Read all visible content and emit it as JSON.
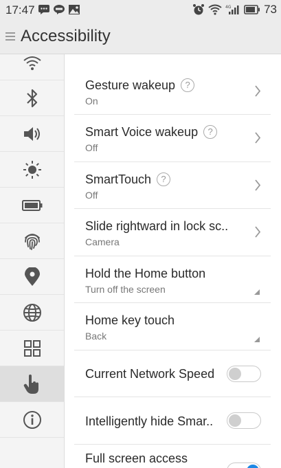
{
  "status_bar": {
    "time": "17:47",
    "battery": "73",
    "left_icons": [
      "message-icon",
      "line-icon",
      "image-icon"
    ],
    "right_icons": [
      "alarm-icon",
      "wifi-icon",
      "signal-4g-icon",
      "battery-icon"
    ]
  },
  "header": {
    "title": "Accessibility"
  },
  "sidebar": {
    "items": [
      {
        "icon": "wifi-icon"
      },
      {
        "icon": "bluetooth-icon"
      },
      {
        "icon": "sound-icon"
      },
      {
        "icon": "brightness-icon"
      },
      {
        "icon": "battery-icon"
      },
      {
        "icon": "fingerprint-icon"
      },
      {
        "icon": "location-icon"
      },
      {
        "icon": "globe-icon"
      },
      {
        "icon": "apps-grid-icon"
      },
      {
        "icon": "hand-pointer-icon",
        "active": true
      },
      {
        "icon": "info-icon"
      }
    ]
  },
  "settings": {
    "gesture_wakeup": {
      "title": "Gesture wakeup",
      "value": "On"
    },
    "smart_voice": {
      "title": "Smart Voice wakeup",
      "value": "Off"
    },
    "smarttouch": {
      "title": "SmartTouch",
      "value": "Off"
    },
    "slide_rightward": {
      "title": "Slide rightward in lock sc..",
      "value": "Camera"
    },
    "hold_home": {
      "title": "Hold the Home button",
      "value": "Turn off the screen"
    },
    "home_key_touch": {
      "title": "Home key touch",
      "value": "Back"
    },
    "network_speed": {
      "title": "Current Network Speed",
      "enabled": false
    },
    "hide_smar": {
      "title": "Intelligently hide Smar..",
      "enabled": false
    },
    "full_screen": {
      "title": "Full screen access",
      "enabled": true
    }
  },
  "help_mark": "?",
  "colors": {
    "accent": "#1e88e5",
    "header_bg": "#ececec",
    "sidebar_bg": "#f4f4f4"
  }
}
